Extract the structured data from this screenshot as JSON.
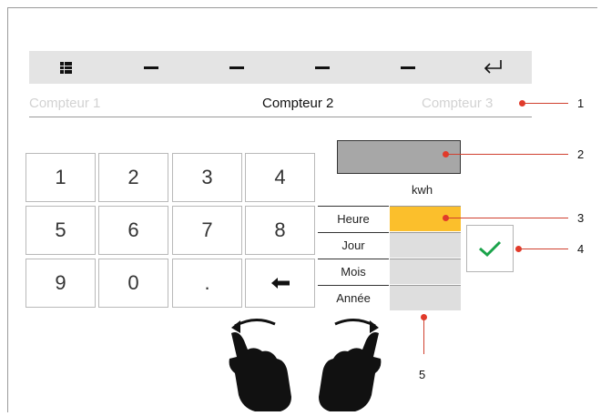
{
  "toolbar": {
    "items": [
      "grid-icon",
      "dash",
      "dash",
      "dash",
      "dash",
      "enter-icon"
    ]
  },
  "tabs": [
    {
      "label": "Compteur 1",
      "state": "dim"
    },
    {
      "label": "Compteur 2",
      "state": "active"
    },
    {
      "label": "Compteur 3",
      "state": "dim"
    }
  ],
  "keypad": {
    "keys": [
      "1",
      "2",
      "3",
      "4",
      "5",
      "6",
      "7",
      "8",
      "9",
      "0",
      ".",
      "←"
    ]
  },
  "meter": {
    "unit": "kwh",
    "rows": [
      {
        "label": "Heure",
        "selected": true
      },
      {
        "label": "Jour",
        "selected": false
      },
      {
        "label": "Mois",
        "selected": false
      },
      {
        "label": "Année",
        "selected": false
      }
    ]
  },
  "callouts": [
    "1",
    "2",
    "3",
    "4",
    "5"
  ],
  "colors": {
    "selected": "#fbbf2c",
    "callout": "#e23a2a",
    "confirm": "#1aa34a"
  }
}
